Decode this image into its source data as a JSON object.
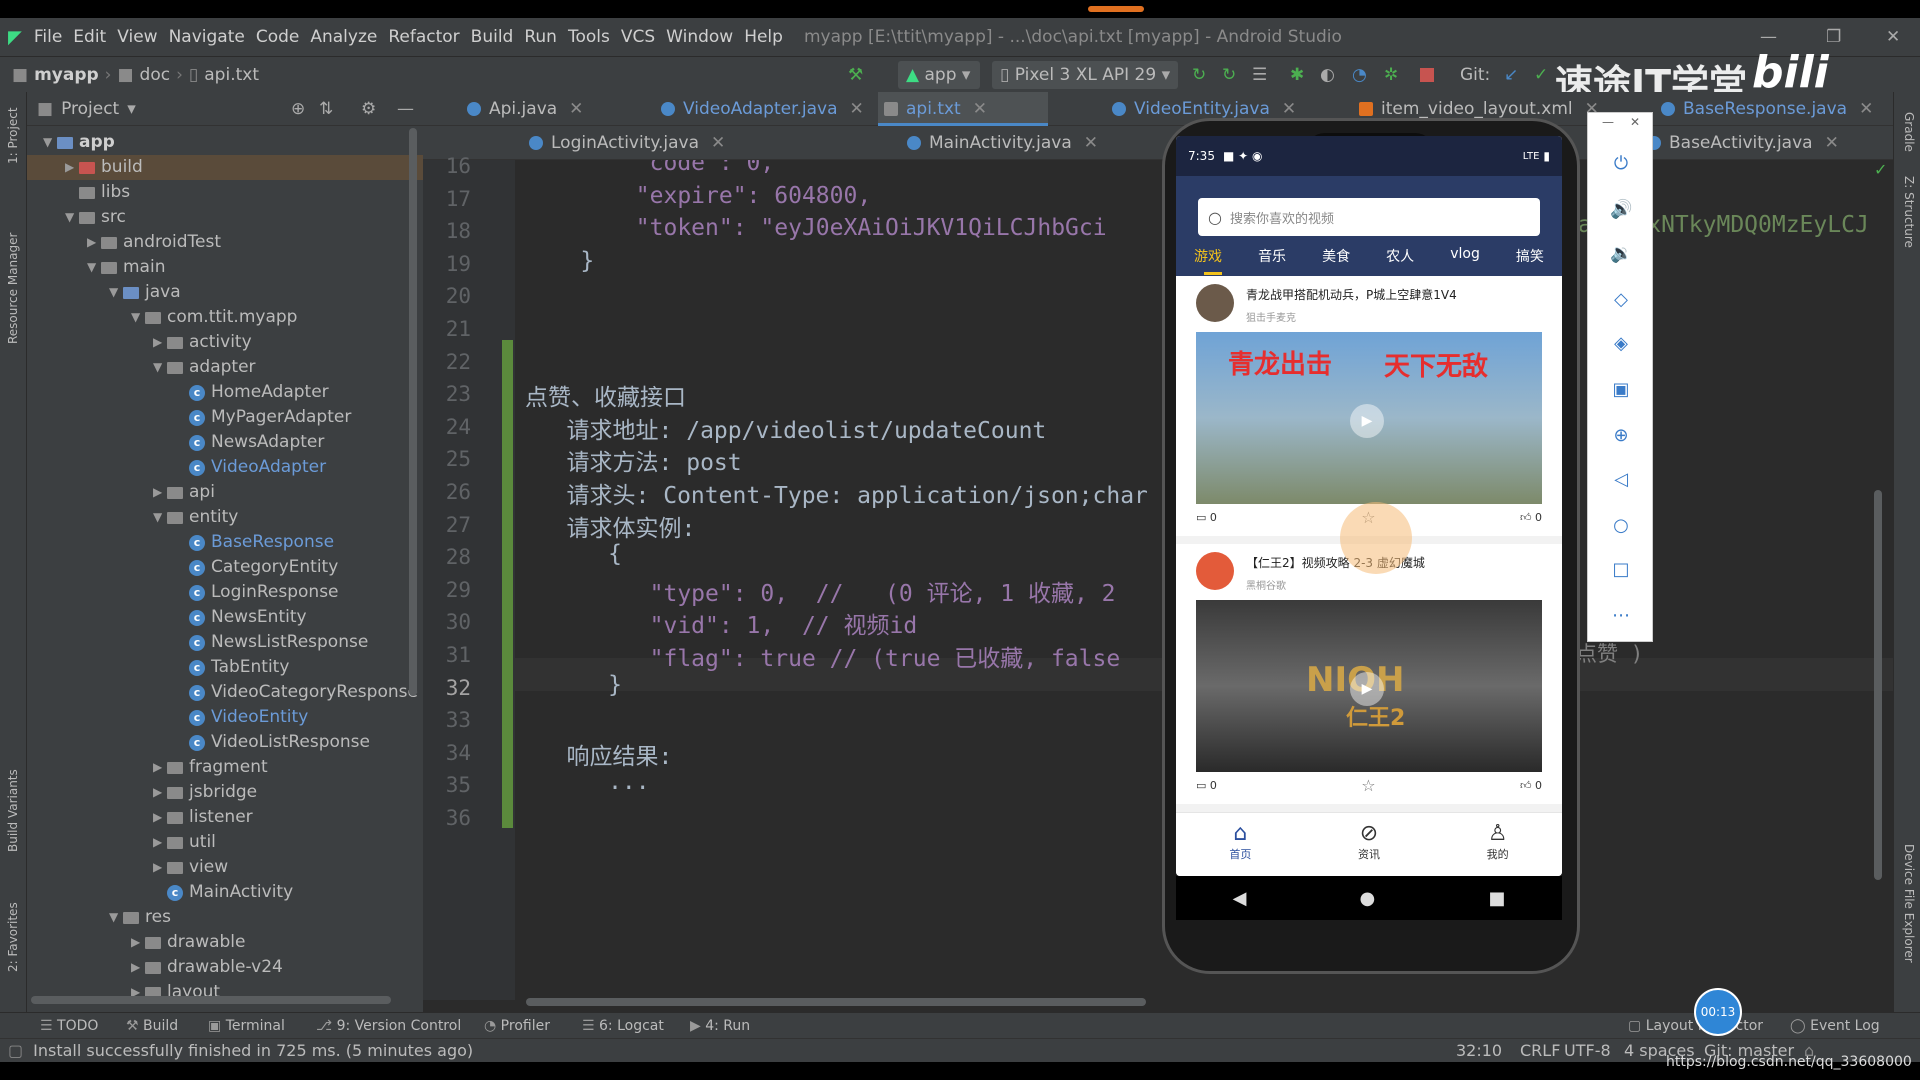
{
  "window": {
    "title": "myapp [E:\\ttit\\myapp] - ...\\doc\\api.txt [myapp] - Android Studio"
  },
  "menu": [
    "File",
    "Edit",
    "View",
    "Navigate",
    "Code",
    "Analyze",
    "Refactor",
    "Build",
    "Run",
    "Tools",
    "VCS",
    "Window",
    "Help"
  ],
  "breadcrumb": {
    "project": "myapp",
    "folder": "doc",
    "file": "api.txt"
  },
  "toolbar": {
    "config": "app",
    "device": "Pixel 3 XL API 29",
    "git": "Git:"
  },
  "watermark": "速途IT学堂",
  "project_panel": {
    "title": "Project",
    "root": "app"
  },
  "tree": [
    {
      "label": "build",
      "depth": 1,
      "kind": "red",
      "arrow": "▶"
    },
    {
      "label": "libs",
      "depth": 1,
      "kind": "folder",
      "arrow": ""
    },
    {
      "label": "src",
      "depth": 1,
      "kind": "folder",
      "arrow": "▼"
    },
    {
      "label": "androidTest",
      "depth": 2,
      "kind": "folder",
      "arrow": "▶"
    },
    {
      "label": "main",
      "depth": 2,
      "kind": "folder",
      "arrow": "▼"
    },
    {
      "label": "java",
      "depth": 3,
      "kind": "blue",
      "arrow": "▼"
    },
    {
      "label": "com.ttit.myapp",
      "depth": 4,
      "kind": "folder",
      "arrow": "▼"
    },
    {
      "label": "activity",
      "depth": 5,
      "kind": "folder",
      "arrow": "▶"
    },
    {
      "label": "adapter",
      "depth": 5,
      "kind": "folder",
      "arrow": "▼"
    },
    {
      "label": "HomeAdapter",
      "depth": 6,
      "kind": "class",
      "arrow": ""
    },
    {
      "label": "MyPagerAdapter",
      "depth": 6,
      "kind": "class",
      "arrow": ""
    },
    {
      "label": "NewsAdapter",
      "depth": 6,
      "kind": "class",
      "arrow": ""
    },
    {
      "label": "VideoAdapter",
      "depth": 6,
      "kind": "class-hl",
      "arrow": ""
    },
    {
      "label": "api",
      "depth": 5,
      "kind": "folder",
      "arrow": "▶"
    },
    {
      "label": "entity",
      "depth": 5,
      "kind": "folder",
      "arrow": "▼"
    },
    {
      "label": "BaseResponse",
      "depth": 6,
      "kind": "class-hl",
      "arrow": ""
    },
    {
      "label": "CategoryEntity",
      "depth": 6,
      "kind": "class",
      "arrow": ""
    },
    {
      "label": "LoginResponse",
      "depth": 6,
      "kind": "class",
      "arrow": ""
    },
    {
      "label": "NewsEntity",
      "depth": 6,
      "kind": "class",
      "arrow": ""
    },
    {
      "label": "NewsListResponse",
      "depth": 6,
      "kind": "class",
      "arrow": ""
    },
    {
      "label": "TabEntity",
      "depth": 6,
      "kind": "class",
      "arrow": ""
    },
    {
      "label": "VideoCategoryResponse",
      "depth": 6,
      "kind": "class",
      "arrow": ""
    },
    {
      "label": "VideoEntity",
      "depth": 6,
      "kind": "class-hl",
      "arrow": ""
    },
    {
      "label": "VideoListResponse",
      "depth": 6,
      "kind": "class",
      "arrow": ""
    },
    {
      "label": "fragment",
      "depth": 5,
      "kind": "folder",
      "arrow": "▶"
    },
    {
      "label": "jsbridge",
      "depth": 5,
      "kind": "folder",
      "arrow": "▶"
    },
    {
      "label": "listener",
      "depth": 5,
      "kind": "folder",
      "arrow": "▶"
    },
    {
      "label": "util",
      "depth": 5,
      "kind": "folder",
      "arrow": "▶"
    },
    {
      "label": "view",
      "depth": 5,
      "kind": "folder",
      "arrow": "▶"
    },
    {
      "label": "MainActivity",
      "depth": 5,
      "kind": "class",
      "arrow": ""
    },
    {
      "label": "res",
      "depth": 3,
      "kind": "folder",
      "arrow": "▼"
    },
    {
      "label": "drawable",
      "depth": 4,
      "kind": "folder",
      "arrow": "▶"
    },
    {
      "label": "drawable-v24",
      "depth": 4,
      "kind": "folder",
      "arrow": "▶"
    },
    {
      "label": "layout",
      "depth": 4,
      "kind": "folder",
      "arrow": "▶"
    }
  ],
  "tabs_row1": [
    "Api.java",
    "VideoAdapter.java",
    "api.txt",
    "VideoEntity.java",
    "item_video_layout.xml",
    "BaseResponse.java"
  ],
  "tabs_row2": [
    "LoginActivity.java",
    "MainActivity.java",
    "BaseActivity.java"
  ],
  "code_lines": [
    {
      "n": "16",
      "t": "        \"code\": 0,"
    },
    {
      "n": "17",
      "t": "        \"expire\": 604800,"
    },
    {
      "n": "18",
      "t": "        \"token\": \"eyJ0eXAiOiJKV1QiLCJhbGci"
    },
    {
      "n": "19",
      "t": "    }"
    },
    {
      "n": "20",
      "t": ""
    },
    {
      "n": "21",
      "t": ""
    },
    {
      "n": "22",
      "t": ""
    },
    {
      "n": "23",
      "t": "点赞、收藏接口"
    },
    {
      "n": "24",
      "t": "   请求地址: /app/videolist/updateCount"
    },
    {
      "n": "25",
      "t": "   请求方法: post"
    },
    {
      "n": "26",
      "t": "   请求头: Content-Type: application/json;char"
    },
    {
      "n": "27",
      "t": "   请求体实例:"
    },
    {
      "n": "28",
      "t": "      {"
    },
    {
      "n": "29",
      "t": "         \"type\": 0,  //   (0 评论, 1 收藏, 2"
    },
    {
      "n": "30",
      "t": "         \"vid\": 1,  // 视频id"
    },
    {
      "n": "31",
      "t": "         \"flag\": true // (true 已收藏, false"
    },
    {
      "n": "32",
      "t": "      }"
    },
    {
      "n": "33",
      "t": ""
    },
    {
      "n": "34",
      "t": "   响应结果:"
    },
    {
      "n": "35",
      "t": "      ..."
    },
    {
      "n": "36",
      "t": ""
    }
  ],
  "code_right": {
    "line18": "a   oxNTkyMDQ0MzEyLCJ",
    "line31": "点赞 )"
  },
  "phone": {
    "time": "7:35",
    "signal": "LTE",
    "search_placeholder": "搜索你喜欢的视频",
    "categories": [
      "游戏",
      "音乐",
      "美食",
      "农人",
      "vlog",
      "搞笑"
    ],
    "videos": [
      {
        "title": "青龙战甲搭配机动兵，P城上空肆意1V4",
        "author": "狙击手麦克",
        "thumb_text1": "青龙出击",
        "thumb_text2": "天下无敌",
        "comments": "0",
        "likes": "0"
      },
      {
        "title": "【仁王2】视频攻略 2-3 虚幻魔城",
        "author": "黑桐谷歌",
        "thumb_text1": "NIOH",
        "thumb_text2": "仁王2",
        "comments": "0",
        "likes": "0"
      }
    ],
    "nav": [
      "首页",
      "资讯",
      "我的"
    ]
  },
  "bottom_tools": [
    "TODO",
    "Build",
    "Terminal",
    "9: Version Control",
    "Profiler",
    "6: Logcat",
    "4: Run",
    "Layout Inspector",
    "Event Log"
  ],
  "status": {
    "message": "Install successfully finished in 725 ms. (5 minutes ago)",
    "position": "32:10",
    "line_sep": "CRLF",
    "encoding": "UTF-8",
    "indent": "4 spaces",
    "branch": "Git: master",
    "timer": "00:13",
    "url": "https://blog.csdn.net/qq_33608000"
  },
  "side_labels": {
    "project": "1: Project",
    "resource": "Resource Manager",
    "variants": "Build Variants",
    "favorites": "2: Favorites",
    "gradle": "Gradle",
    "structure": "Z: Structure",
    "device_explorer": "Device File Explorer"
  },
  "colors": {
    "ide_bg": "#2b2b2b",
    "panel": "#3c3f41",
    "accent": "#4a88c7",
    "phone_accent": "#2b4f9e"
  }
}
